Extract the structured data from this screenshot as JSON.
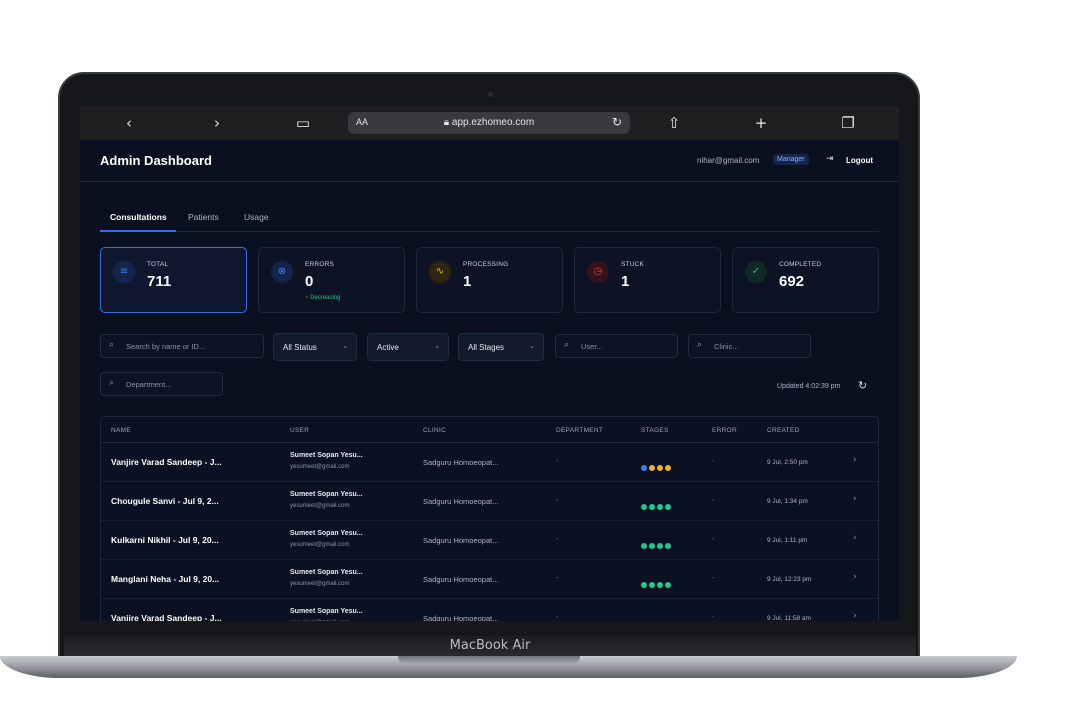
{
  "device": {
    "label": "MacBook Air"
  },
  "browser": {
    "text_size_label": "AA",
    "url": "app.ezhomeo.com",
    "icons": [
      "chevron-left-icon",
      "chevron-right-icon",
      "book-icon",
      "lock-icon",
      "reload-icon",
      "share-icon",
      "plus-icon",
      "tabs-icon"
    ]
  },
  "header": {
    "title": "Admin Dashboard",
    "email": "nihar@gmail.com",
    "role": "Manager",
    "logout_label": "Logout"
  },
  "tabs": [
    {
      "label": "Consultations",
      "active": true
    },
    {
      "label": "Patients",
      "active": false
    },
    {
      "label": "Usage",
      "active": false
    }
  ],
  "stats": [
    {
      "label": "TOTAL",
      "value": "711",
      "icon": "database-icon",
      "color": "#3b82f6"
    },
    {
      "label": "ERRORS",
      "value": "0",
      "trend": "~ Decreasing",
      "icon": "x-circle-icon",
      "color": "#3b82f6"
    },
    {
      "label": "PROCESSING",
      "value": "1",
      "icon": "activity-icon",
      "color": "#f5b41f"
    },
    {
      "label": "STUCK",
      "value": "1",
      "icon": "clock-icon",
      "color": "#ef4444"
    },
    {
      "label": "COMPLETED",
      "value": "692",
      "icon": "check-circle-icon",
      "color": "#22c58b"
    }
  ],
  "filters": {
    "search_placeholder": "Search by name or ID...",
    "status_value": "All Status",
    "active_value": "Active",
    "stages_value": "All Stages",
    "user_placeholder": "User...",
    "clinic_placeholder": "Clinic...",
    "department_placeholder": "Department..."
  },
  "updated": "Updated 4:02:39 pm",
  "table": {
    "columns": [
      "NAME",
      "USER",
      "CLINIC",
      "DEPARTMENT",
      "STAGES",
      "ERROR",
      "CREATED"
    ],
    "rows": [
      {
        "name": "Vanjire Varad Sandeep - J...",
        "user": "Sumeet Sopan Yesu...",
        "email": "yesumeet@gmail.com",
        "clinic": "Sadguru Homoeopat...",
        "department": "-",
        "stages": [
          "#3b82f6",
          "#f5b41f",
          "#f5b41f",
          "#f5b41f"
        ],
        "error": "-",
        "created": "9 Jul, 2:50 pm"
      },
      {
        "name": "Chougule Sanvi - Jul 9, 2...",
        "user": "Sumeet Sopan Yesu...",
        "email": "yesumeet@gmail.com",
        "clinic": "Sadguru Homoeopat...",
        "department": "-",
        "stages": [
          "#22c58b",
          "#22c58b",
          "#22c58b",
          "#22c58b"
        ],
        "error": "-",
        "created": "9 Jul, 1:34 pm"
      },
      {
        "name": "Kulkarni Nikhil - Jul 9, 20...",
        "user": "Sumeet Sopan Yesu...",
        "email": "yesumeet@gmail.com",
        "clinic": "Sadguru Homoeopat...",
        "department": "-",
        "stages": [
          "#22c58b",
          "#22c58b",
          "#22c58b",
          "#22c58b"
        ],
        "error": "-",
        "created": "9 Jul, 1:11 pm"
      },
      {
        "name": "Manglani Neha - Jul 9, 20...",
        "user": "Sumeet Sopan Yesu...",
        "email": "yesumeet@gmail.com",
        "clinic": "Sadguru Homoeopat...",
        "department": "-",
        "stages": [
          "#22c58b",
          "#22c58b",
          "#22c58b",
          "#22c58b"
        ],
        "error": "-",
        "created": "9 Jul, 12:23 pm"
      },
      {
        "name": "Vanjire Varad Sandeep - J...",
        "user": "Sumeet Sopan Yesu...",
        "email": "yesumeet@gmail.com",
        "clinic": "Sadguru Homoeopat...",
        "department": "-",
        "stages": [
          "#22c58b",
          "#22c58b",
          "#22c58b",
          "#22c58b"
        ],
        "error": "-",
        "created": "9 Jul, 11:58 am"
      }
    ]
  }
}
